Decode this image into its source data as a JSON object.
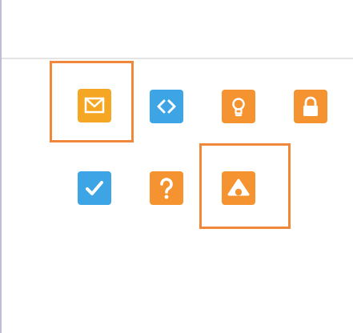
{
  "divider_color": "#e4e4e4",
  "highlight_color": "#f0873a",
  "icons": [
    {
      "name": "mail-icon",
      "color": "#f5a623"
    },
    {
      "name": "code-icon",
      "color": "#3da5e6"
    },
    {
      "name": "lightbulb-icon",
      "color": "#f4932f"
    },
    {
      "name": "lock-icon",
      "color": "#f4932f"
    },
    {
      "name": "checkmark-icon",
      "color": "#3da5e6"
    },
    {
      "name": "question-mark-icon",
      "color": "#f4932f"
    },
    {
      "name": "triangle-alert-icon",
      "color": "#f4932f"
    }
  ]
}
